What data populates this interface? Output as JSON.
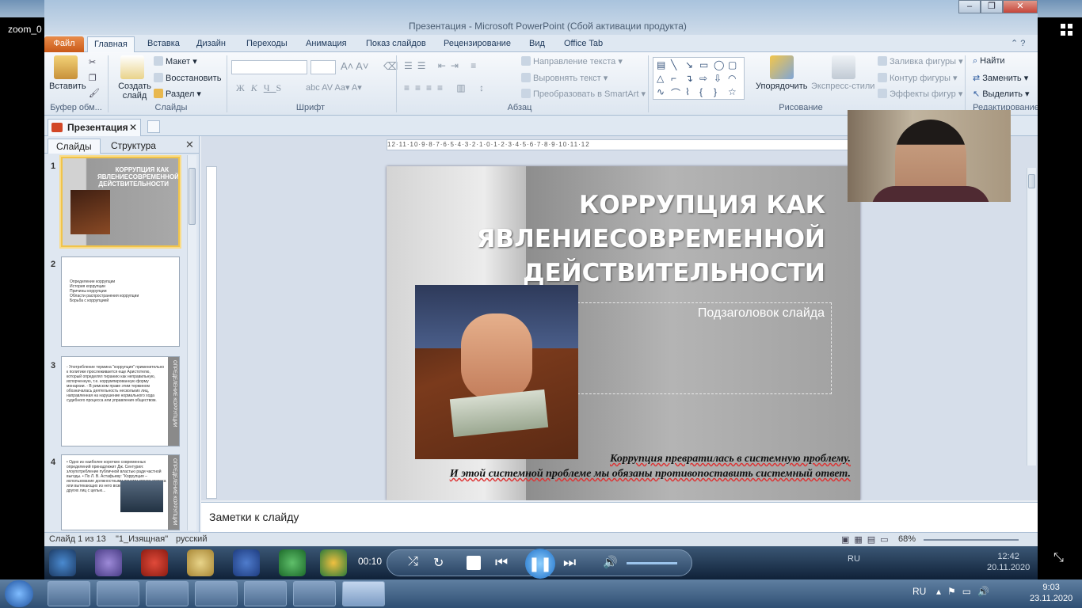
{
  "zoom": {
    "label": "zoom_0"
  },
  "window": {
    "title": "Презентация - Microsoft PowerPoint (Сбой активации продукта)"
  },
  "tabs": [
    "Файл",
    "Главная",
    "Вставка",
    "Дизайн",
    "Переходы",
    "Анимация",
    "Показ слайдов",
    "Рецензирование",
    "Вид",
    "Office Tab"
  ],
  "ribbon": {
    "paste": "Вставить",
    "clipboard": "Буфер обм...",
    "new_slide": "Создать слайд",
    "layout": "Макет",
    "reset": "Восстановить",
    "section": "Раздел",
    "slides_group": "Слайды",
    "font_group": "Шрифт",
    "paragraph_group": "Абзац",
    "text_direction": "Направление текста",
    "align_text": "Выровнять текст",
    "smartart": "Преобразовать в SmartArt",
    "arrange": "Упорядочить",
    "quick_styles": "Экспресс-стили",
    "shape_fill": "Заливка фигуры",
    "shape_outline": "Контур фигуры",
    "shape_effects": "Эффекты фигур",
    "drawing_group": "Рисование",
    "find": "Найти",
    "replace": "Заменить",
    "select": "Выделить",
    "editing_group": "Редактирование"
  },
  "doc_tab": "Презентация",
  "panel": {
    "tab_slides": "Слайды",
    "tab_outline": "Структура",
    "thumb1_title": "КОРРУПЦИЯ КАК ЯВЛЕНИЕСОВРЕМЕННОЙ ДЕЙСТВИТЕЛЬНОСТИ",
    "thumb2_items": [
      "Определение коррупции",
      "История коррупции",
      "Причины коррупции",
      "Области распространения коррупции",
      "Борьба с коррупцией"
    ],
    "thumb3_text": "- Употребление термина \"коррупция\" применительно к политике прослеживается еще Аристотелю, который определял тиранию как неправильную, испорченную, т.е. коррумпированную форму монархии. - В римском праве этим термином обозначалась деятельность нескольких лиц, направленная на нарушение нормального хода судебного процесса или управления обществом.",
    "thumb3_side": "ОПРЕДЕЛЕНИЕ КОРРУПЦИИ",
    "thumb4_text": "• Одно из наиболее коротких современных определений принадлежит Дж. Сентурия: злоупотребление публичной властью ради частной выгоды. • По Л. В. Астафьеву: \"Коррупция – использование должностными лицами своего статуса или вытекающих из него возможностей в интересах других лиц с целью...",
    "thumb4_side": "ОПРЕДЕЛЕНИЕ КОРРУПЦИИ",
    "numbers": [
      "1",
      "2",
      "3",
      "4"
    ]
  },
  "ruler": {
    "h": "12·11·10·9·8·7·6·5·4·3·2·1·0·1·2·3·4·5·6·7·8·9·10·11·12"
  },
  "slide": {
    "title": "КОРРУПЦИЯ КАК ЯВЛЕНИЕСОВРЕМЕННОЙ ДЕЙСТВИТЕЛЬНОСТИ",
    "subtitle": "Подзаголовок слайда",
    "quote_line1": "Коррупция превратилась в системную проблему.",
    "quote_line2": "И этой системной проблеме мы обязаны противопоставить системный ответ."
  },
  "notes": {
    "placeholder": "Заметки к слайду"
  },
  "status": {
    "slide": "Слайд 1 из 13",
    "theme": "\"1_Изящная\"",
    "lang": "русский",
    "zoom": "68%"
  },
  "media": {
    "time": "00:10",
    "inner_clock_time": "12:42",
    "inner_clock_date": "20.11.2020",
    "inner_lang": "RU"
  },
  "taskbar": {
    "lang": "RU",
    "time": "9:03",
    "date": "23.11.2020"
  },
  "colors": {
    "file_tab": "#d0651f",
    "selection": "#f1c44a",
    "taskbar": "#3d5f86"
  }
}
